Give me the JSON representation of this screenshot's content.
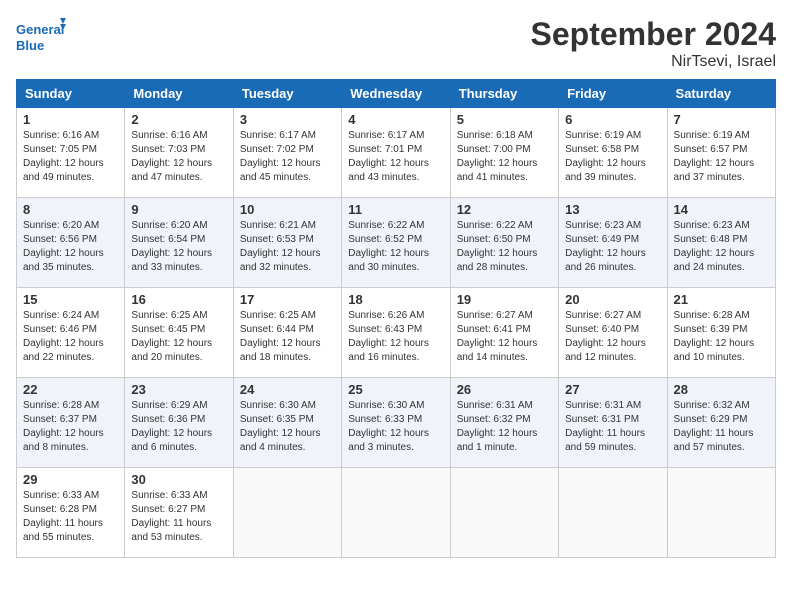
{
  "header": {
    "logo_line1": "General",
    "logo_line2": "Blue",
    "month_title": "September 2024",
    "location": "NirTsevi, Israel"
  },
  "days_of_week": [
    "Sunday",
    "Monday",
    "Tuesday",
    "Wednesday",
    "Thursday",
    "Friday",
    "Saturday"
  ],
  "weeks": [
    [
      {
        "day": "1",
        "sunrise": "6:16 AM",
        "sunset": "7:05 PM",
        "daylight": "12 hours and 49 minutes."
      },
      {
        "day": "2",
        "sunrise": "6:16 AM",
        "sunset": "7:03 PM",
        "daylight": "12 hours and 47 minutes."
      },
      {
        "day": "3",
        "sunrise": "6:17 AM",
        "sunset": "7:02 PM",
        "daylight": "12 hours and 45 minutes."
      },
      {
        "day": "4",
        "sunrise": "6:17 AM",
        "sunset": "7:01 PM",
        "daylight": "12 hours and 43 minutes."
      },
      {
        "day": "5",
        "sunrise": "6:18 AM",
        "sunset": "7:00 PM",
        "daylight": "12 hours and 41 minutes."
      },
      {
        "day": "6",
        "sunrise": "6:19 AM",
        "sunset": "6:58 PM",
        "daylight": "12 hours and 39 minutes."
      },
      {
        "day": "7",
        "sunrise": "6:19 AM",
        "sunset": "6:57 PM",
        "daylight": "12 hours and 37 minutes."
      }
    ],
    [
      {
        "day": "8",
        "sunrise": "6:20 AM",
        "sunset": "6:56 PM",
        "daylight": "12 hours and 35 minutes."
      },
      {
        "day": "9",
        "sunrise": "6:20 AM",
        "sunset": "6:54 PM",
        "daylight": "12 hours and 33 minutes."
      },
      {
        "day": "10",
        "sunrise": "6:21 AM",
        "sunset": "6:53 PM",
        "daylight": "12 hours and 32 minutes."
      },
      {
        "day": "11",
        "sunrise": "6:22 AM",
        "sunset": "6:52 PM",
        "daylight": "12 hours and 30 minutes."
      },
      {
        "day": "12",
        "sunrise": "6:22 AM",
        "sunset": "6:50 PM",
        "daylight": "12 hours and 28 minutes."
      },
      {
        "day": "13",
        "sunrise": "6:23 AM",
        "sunset": "6:49 PM",
        "daylight": "12 hours and 26 minutes."
      },
      {
        "day": "14",
        "sunrise": "6:23 AM",
        "sunset": "6:48 PM",
        "daylight": "12 hours and 24 minutes."
      }
    ],
    [
      {
        "day": "15",
        "sunrise": "6:24 AM",
        "sunset": "6:46 PM",
        "daylight": "12 hours and 22 minutes."
      },
      {
        "day": "16",
        "sunrise": "6:25 AM",
        "sunset": "6:45 PM",
        "daylight": "12 hours and 20 minutes."
      },
      {
        "day": "17",
        "sunrise": "6:25 AM",
        "sunset": "6:44 PM",
        "daylight": "12 hours and 18 minutes."
      },
      {
        "day": "18",
        "sunrise": "6:26 AM",
        "sunset": "6:43 PM",
        "daylight": "12 hours and 16 minutes."
      },
      {
        "day": "19",
        "sunrise": "6:27 AM",
        "sunset": "6:41 PM",
        "daylight": "12 hours and 14 minutes."
      },
      {
        "day": "20",
        "sunrise": "6:27 AM",
        "sunset": "6:40 PM",
        "daylight": "12 hours and 12 minutes."
      },
      {
        "day": "21",
        "sunrise": "6:28 AM",
        "sunset": "6:39 PM",
        "daylight": "12 hours and 10 minutes."
      }
    ],
    [
      {
        "day": "22",
        "sunrise": "6:28 AM",
        "sunset": "6:37 PM",
        "daylight": "12 hours and 8 minutes."
      },
      {
        "day": "23",
        "sunrise": "6:29 AM",
        "sunset": "6:36 PM",
        "daylight": "12 hours and 6 minutes."
      },
      {
        "day": "24",
        "sunrise": "6:30 AM",
        "sunset": "6:35 PM",
        "daylight": "12 hours and 4 minutes."
      },
      {
        "day": "25",
        "sunrise": "6:30 AM",
        "sunset": "6:33 PM",
        "daylight": "12 hours and 3 minutes."
      },
      {
        "day": "26",
        "sunrise": "6:31 AM",
        "sunset": "6:32 PM",
        "daylight": "12 hours and 1 minute."
      },
      {
        "day": "27",
        "sunrise": "6:31 AM",
        "sunset": "6:31 PM",
        "daylight": "11 hours and 59 minutes."
      },
      {
        "day": "28",
        "sunrise": "6:32 AM",
        "sunset": "6:29 PM",
        "daylight": "11 hours and 57 minutes."
      }
    ],
    [
      {
        "day": "29",
        "sunrise": "6:33 AM",
        "sunset": "6:28 PM",
        "daylight": "11 hours and 55 minutes."
      },
      {
        "day": "30",
        "sunrise": "6:33 AM",
        "sunset": "6:27 PM",
        "daylight": "11 hours and 53 minutes."
      },
      null,
      null,
      null,
      null,
      null
    ]
  ]
}
